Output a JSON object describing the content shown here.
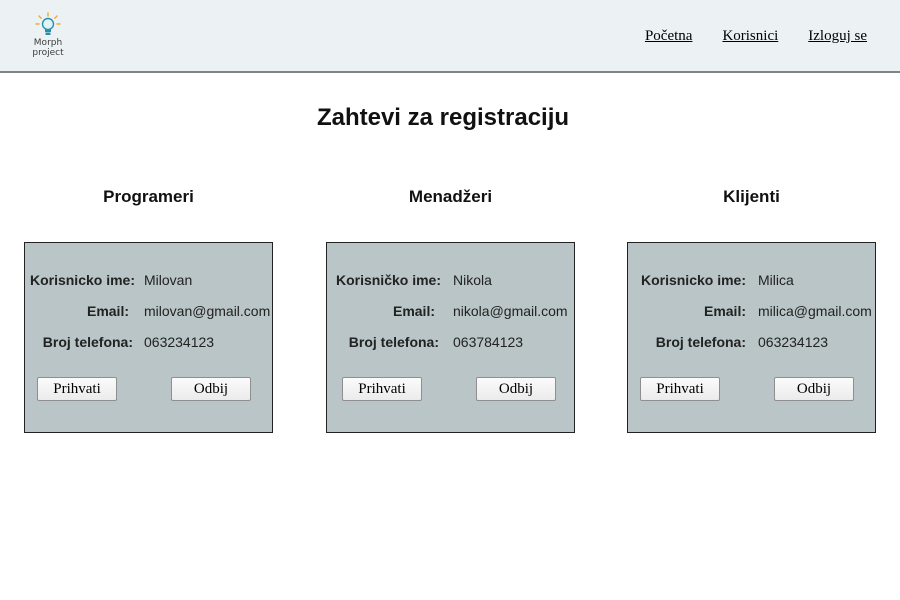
{
  "header": {
    "logo_line1": "Morph",
    "logo_line2": "project",
    "nav": [
      "Početna",
      "Korisnici",
      "Izloguj se"
    ]
  },
  "page_title": "Zahtevi za registraciju",
  "columns": [
    {
      "title": "Programeri",
      "label_username": "Korisnicko ime:",
      "label_email": "Email:",
      "label_phone": "Broj telefona:",
      "username": "Milovan",
      "email": "milovan@gmail.com",
      "phone": "063234123",
      "accept": "Prihvati",
      "reject": "Odbij"
    },
    {
      "title": "Menadžeri",
      "label_username": "Korisničko ime:",
      "label_email": "Email:",
      "label_phone": "Broj telefona:",
      "username": "Nikola",
      "email": "nikola@gmail.com",
      "phone": "063784123",
      "accept": "Prihvati",
      "reject": "Odbij"
    },
    {
      "title": "Klijenti",
      "label_username": "Korisnicko ime:",
      "label_email": "Email:",
      "label_phone": "Broj telefona:",
      "username": "Milica",
      "email": "milica@gmail.com",
      "phone": "063234123",
      "accept": "Prihvati",
      "reject": "Odbij"
    }
  ],
  "colors": {
    "header_bg": "#ecf2f4",
    "card_bg": "#b9c5c6"
  }
}
